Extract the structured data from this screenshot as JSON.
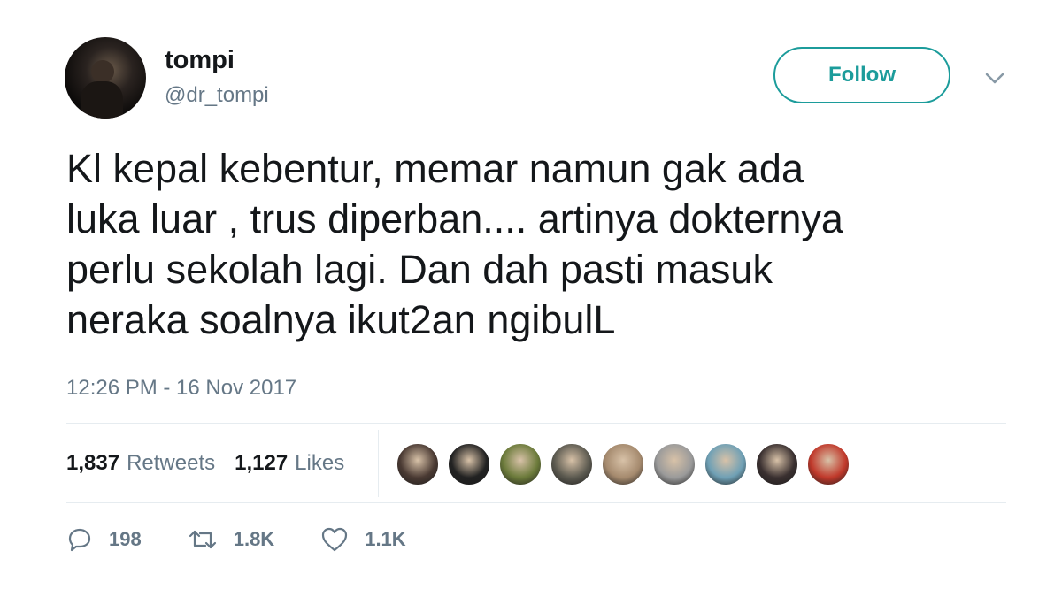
{
  "user": {
    "name": "tompi",
    "handle": "@dr_tompi"
  },
  "follow_label": "Follow",
  "tweet": {
    "text": "Kl kepal kebentur, memar namun gak ada\nluka luar , trus diperban.... artinya dokternya\nperlu sekolah lagi. Dan dah pasti masuk\nneraka soalnya ikut2an ngibulL",
    "timestamp": "12:26 PM - 16 Nov 2017"
  },
  "stats": {
    "retweets_count": "1,837",
    "retweets_label": "Retweets",
    "likes_count": "1,127",
    "likes_label": "Likes"
  },
  "likers": [
    {
      "color": "#4a3a33"
    },
    {
      "color": "#222222"
    },
    {
      "color": "#6b7a3a"
    },
    {
      "color": "#5c5a50"
    },
    {
      "color": "#a58a6e"
    },
    {
      "color": "#9a9a9a"
    },
    {
      "color": "#6fa0b5"
    },
    {
      "color": "#3a3030"
    },
    {
      "color": "#c0392b"
    }
  ],
  "actions": {
    "replies": "198",
    "retweets": "1.8K",
    "likes": "1.1K"
  },
  "colors": {
    "accent": "#1c9c9b",
    "muted": "#657786",
    "text": "#14171a"
  }
}
